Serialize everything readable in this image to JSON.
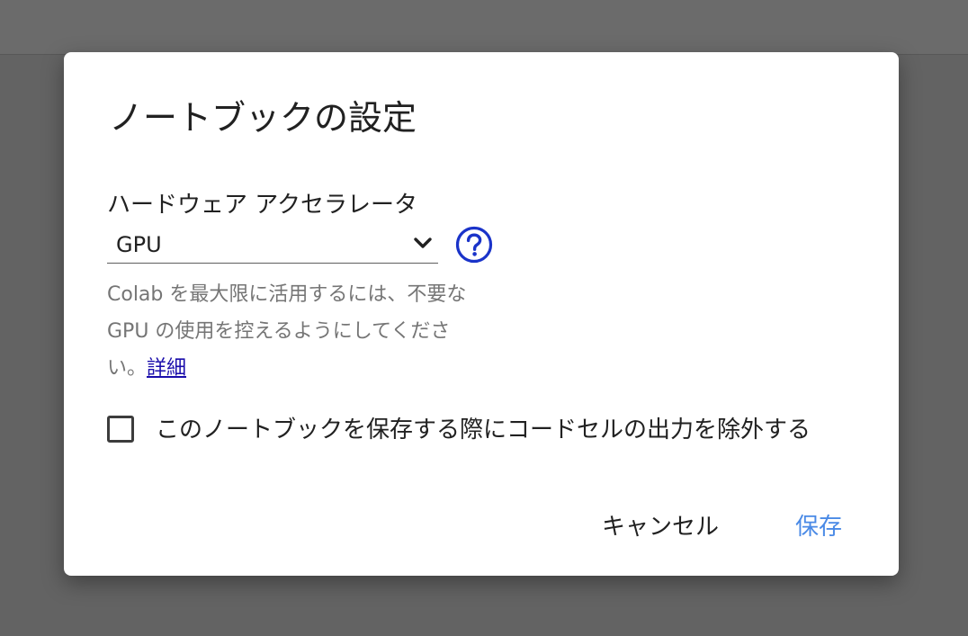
{
  "dialog": {
    "title": "ノートブックの設定",
    "accelerator_label": "ハードウェア アクセラレータ",
    "accelerator_value": "GPU",
    "hint_lines": [
      "Colab を最大限に活用するには、不要な",
      "GPU の使用を控えるようにしてくださ",
      "い。"
    ],
    "hint_link": "詳細",
    "checkbox_label": "このノートブックを保存する際にコードセルの出力を除外する",
    "checkbox_checked": false,
    "cancel_label": "キャンセル",
    "save_label": "保存"
  },
  "colors": {
    "accent": "#4a8ae6",
    "help_icon": "#1a33c9",
    "link": "#1a0dab",
    "backdrop": "#636363"
  },
  "icons": {
    "select_arrow": "chevron-down-icon",
    "help": "help-circle-icon"
  }
}
